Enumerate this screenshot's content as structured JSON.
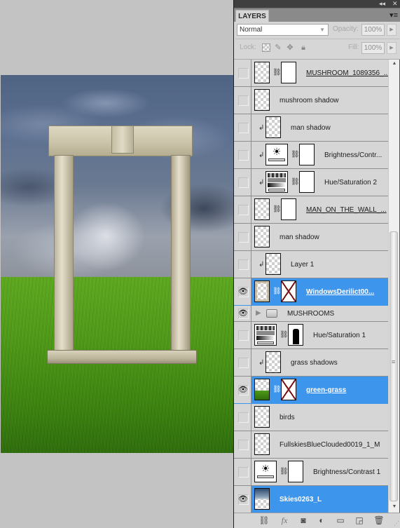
{
  "canvas": {
    "scene": "stone window frame standing on a green grass field under a stormy cloudy sky"
  },
  "panel": {
    "title_controls": {
      "collapse": "◂◂",
      "close": "✕"
    },
    "tab_label": "LAYERS",
    "menu_icon": "▾≡",
    "blend_mode": "Normal",
    "opacity_label": "Opacity:",
    "opacity_value": "100%",
    "lock_label": "Lock:",
    "fill_label": "Fill:",
    "fill_value": "100%"
  },
  "layers": [
    {
      "name": "MUSHROOM_1089356_...",
      "visible": false,
      "type": "smart-object",
      "has_mask": true,
      "clipped": false,
      "selected": false
    },
    {
      "name": "mushroom shadow",
      "visible": false,
      "type": "pixel",
      "has_mask": false,
      "clipped": false,
      "selected": false
    },
    {
      "name": "man shadow",
      "visible": false,
      "type": "pixel",
      "has_mask": false,
      "clipped": true,
      "selected": false
    },
    {
      "name": "Brightness/Contr...",
      "visible": false,
      "type": "brightness-contrast",
      "has_mask": true,
      "clipped": true,
      "selected": false
    },
    {
      "name": "Hue/Saturation 2",
      "visible": false,
      "type": "hue-saturation",
      "has_mask": true,
      "clipped": true,
      "selected": false
    },
    {
      "name": "MAN_ON_THE_WALL_...",
      "visible": false,
      "type": "smart-object",
      "has_mask": true,
      "clipped": false,
      "selected": false
    },
    {
      "name": "man shadow",
      "visible": false,
      "type": "pixel",
      "has_mask": false,
      "clipped": false,
      "selected": false
    },
    {
      "name": "Layer 1",
      "visible": false,
      "type": "pixel",
      "has_mask": false,
      "clipped": true,
      "selected": false
    },
    {
      "name": "WindowsDerilict00...",
      "visible": true,
      "type": "smart-object",
      "has_mask": true,
      "mask_disabled": true,
      "clipped": false,
      "selected": true
    },
    {
      "name": "MUSHROOMS",
      "visible": true,
      "type": "group",
      "collapsed": true,
      "selected": false
    },
    {
      "name": "Hue/Saturation 1",
      "visible": false,
      "type": "hue-saturation",
      "has_mask": true,
      "clipped": false,
      "selected": false
    },
    {
      "name": "grass shadows",
      "visible": false,
      "type": "pixel",
      "has_mask": false,
      "clipped": true,
      "selected": false
    },
    {
      "name": "green-grass",
      "visible": true,
      "type": "smart-object",
      "has_mask": true,
      "mask_disabled": true,
      "clipped": false,
      "selected": true
    },
    {
      "name": "birds",
      "visible": false,
      "type": "pixel",
      "has_mask": false,
      "clipped": false,
      "selected": false
    },
    {
      "name": "FullskiesBlueClouded0019_1_M",
      "visible": false,
      "type": "pixel",
      "has_mask": false,
      "clipped": false,
      "selected": false
    },
    {
      "name": "Brightness/Contrast 1",
      "visible": false,
      "type": "brightness-contrast",
      "has_mask": true,
      "clipped": false,
      "selected": false
    },
    {
      "name": "Skies0263_L",
      "visible": true,
      "type": "pixel",
      "has_mask": false,
      "clipped": false,
      "selected": true
    }
  ],
  "footer_icons": [
    "link-layers-icon",
    "fx-icon",
    "add-mask-icon",
    "adjustment-layer-icon",
    "new-group-icon",
    "new-layer-icon",
    "trash-icon"
  ],
  "colors": {
    "selection": "#3d95ec",
    "panel_bg": "#d6d6d6",
    "workspace_bg": "#c3c3c3"
  }
}
